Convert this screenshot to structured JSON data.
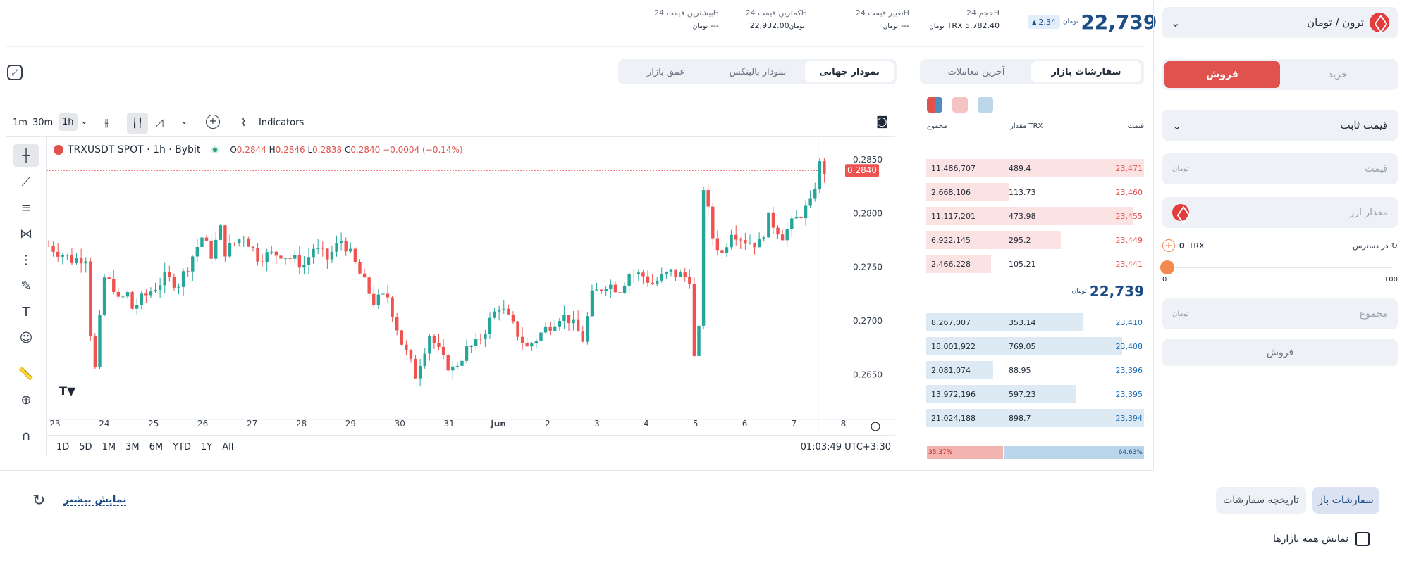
{
  "market": {
    "pair": "ترون / تومان",
    "price": "22,739",
    "price_unit": "تومان",
    "change": "2.34"
  },
  "stats": [
    {
      "label": "حجم 24H",
      "value": "TRX 5,782.40"
    },
    {
      "label": "تغییر قیمت 24H",
      "value": "---"
    },
    {
      "label": "کمترین قیمت 24H",
      "value": "22,932.00"
    },
    {
      "label": "بیشترین قیمت 24H",
      "value": "---"
    }
  ],
  "trade": {
    "buy": "خرید",
    "sell": "فروش",
    "order_type": "قیمت ثابت",
    "price_ph": "قیمت",
    "amount_ph": "مقدار ارز",
    "available": "در دسترس",
    "available_val": "0",
    "available_cur": "TRX",
    "slider_min": "0",
    "slider_max": "100",
    "slider_value": 0,
    "total_ph": "مجموع",
    "submit": "فروش"
  },
  "orderbook": {
    "tabs": [
      "سفارشات بازار",
      "آخرین معاملات"
    ],
    "headers": {
      "price": "قیمت",
      "amount": "مقدار TRX",
      "total": "مجموع"
    },
    "asks": [
      {
        "p": "23,471",
        "a": "489.4",
        "t": "11,486,707"
      },
      {
        "p": "23,460",
        "a": "113.73",
        "t": "2,668,106"
      },
      {
        "p": "23,455",
        "a": "473.98",
        "t": "11,117,201"
      },
      {
        "p": "23,449",
        "a": "295.2",
        "t": "6,922,145"
      },
      {
        "p": "23,441",
        "a": "105.21",
        "t": "2,466,228"
      }
    ],
    "mid": "22,739",
    "bids": [
      {
        "p": "23,410",
        "a": "353.14",
        "t": "8,267,007"
      },
      {
        "p": "23,408",
        "a": "769.05",
        "t": "18,001,922"
      },
      {
        "p": "23,396",
        "a": "88.95",
        "t": "2,081,074"
      },
      {
        "p": "23,395",
        "a": "597.23",
        "t": "13,972,196"
      },
      {
        "p": "23,394",
        "a": "898.7",
        "t": "21,024,188"
      }
    ],
    "sell_pct": "35.37%",
    "buy_pct": "64.63%"
  },
  "chart_tabs": [
    "نمودار جهانی",
    "نمودار بالینکس",
    "عمق بازار"
  ],
  "toolbar": {
    "intervals": [
      "1m",
      "30m",
      "1h"
    ],
    "indicators": "Indicators"
  },
  "legend": {
    "symbol": "TRXUSDT SPOT · 1h · Bybit",
    "o": "0.2844",
    "h": "0.2846",
    "l": "0.2838",
    "c": "0.2840",
    "chg": "−0.0004 (−0.14%)"
  },
  "chart_data": {
    "type": "candlestick",
    "symbol": "TRXUSDT",
    "interval": "1h",
    "ylim": [
      0.2615,
      0.2865
    ],
    "yticks": [
      "0.2850",
      "0.2800",
      "0.2750",
      "0.2700",
      "0.2650"
    ],
    "xticks": [
      "23",
      "24",
      "25",
      "26",
      "27",
      "28",
      "29",
      "30",
      "31",
      "Jun",
      "2",
      "3",
      "4",
      "5",
      "6",
      "7",
      "8"
    ],
    "last_price": "0.2840",
    "path": [
      [
        0,
        0.277
      ],
      [
        5,
        0.2757
      ],
      [
        8,
        0.276
      ],
      [
        9,
        0.269
      ],
      [
        10,
        0.2655
      ],
      [
        11,
        0.27
      ],
      [
        12,
        0.274
      ],
      [
        14,
        0.2732
      ],
      [
        15,
        0.2718
      ],
      [
        17,
        0.2725
      ],
      [
        18,
        0.2712
      ],
      [
        22,
        0.2728
      ],
      [
        25,
        0.274
      ],
      [
        28,
        0.2735
      ],
      [
        30,
        0.2752
      ],
      [
        33,
        0.2778
      ],
      [
        35,
        0.2762
      ],
      [
        37,
        0.2785
      ],
      [
        38,
        0.2765
      ],
      [
        42,
        0.278
      ],
      [
        45,
        0.276
      ],
      [
        50,
        0.2763
      ],
      [
        55,
        0.2752
      ],
      [
        57,
        0.2768
      ],
      [
        60,
        0.2758
      ],
      [
        63,
        0.2775
      ],
      [
        64,
        0.277
      ],
      [
        68,
        0.2735
      ],
      [
        70,
        0.2718
      ],
      [
        73,
        0.2723
      ],
      [
        76,
        0.268
      ],
      [
        79,
        0.265
      ],
      [
        82,
        0.2688
      ],
      [
        85,
        0.2663
      ],
      [
        87,
        0.2655
      ],
      [
        90,
        0.2673
      ],
      [
        92,
        0.2678
      ],
      [
        95,
        0.27
      ],
      [
        97,
        0.2715
      ],
      [
        100,
        0.2695
      ],
      [
        103,
        0.2675
      ],
      [
        107,
        0.2693
      ],
      [
        110,
        0.2705
      ],
      [
        112,
        0.2702
      ],
      [
        115,
        0.2683
      ],
      [
        117,
        0.2723
      ],
      [
        120,
        0.2735
      ],
      [
        123,
        0.273
      ],
      [
        125,
        0.2745
      ],
      [
        128,
        0.2742
      ],
      [
        130,
        0.2735
      ],
      [
        134,
        0.2745
      ],
      [
        138,
        0.274
      ],
      [
        139,
        0.2665
      ],
      [
        140,
        0.269
      ],
      [
        141,
        0.2825
      ],
      [
        143,
        0.2778
      ],
      [
        145,
        0.2762
      ],
      [
        147,
        0.2785
      ],
      [
        150,
        0.2775
      ],
      [
        153,
        0.2772
      ],
      [
        155,
        0.2795
      ],
      [
        158,
        0.278
      ],
      [
        162,
        0.28
      ],
      [
        164,
        0.2808
      ],
      [
        166,
        0.2845
      ],
      [
        167,
        0.284
      ]
    ]
  },
  "timeframes": [
    "1D",
    "5D",
    "1M",
    "3M",
    "6M",
    "YTD",
    "1Y",
    "All"
  ],
  "clock": "01:03:49 UTC+3:30",
  "bottom": {
    "open_orders": "سفارشات باز",
    "history": "تاریخچه سفارشات",
    "show_more": "نمایش بیشتر",
    "show_all": "نمایش همه بازارها"
  },
  "colors": {
    "accent": "#1d4d86",
    "sell": "#e0524d",
    "buy": "#2f9e78",
    "ask_bg": "#fbe3e3",
    "bid_bg": "#dde9f3"
  }
}
